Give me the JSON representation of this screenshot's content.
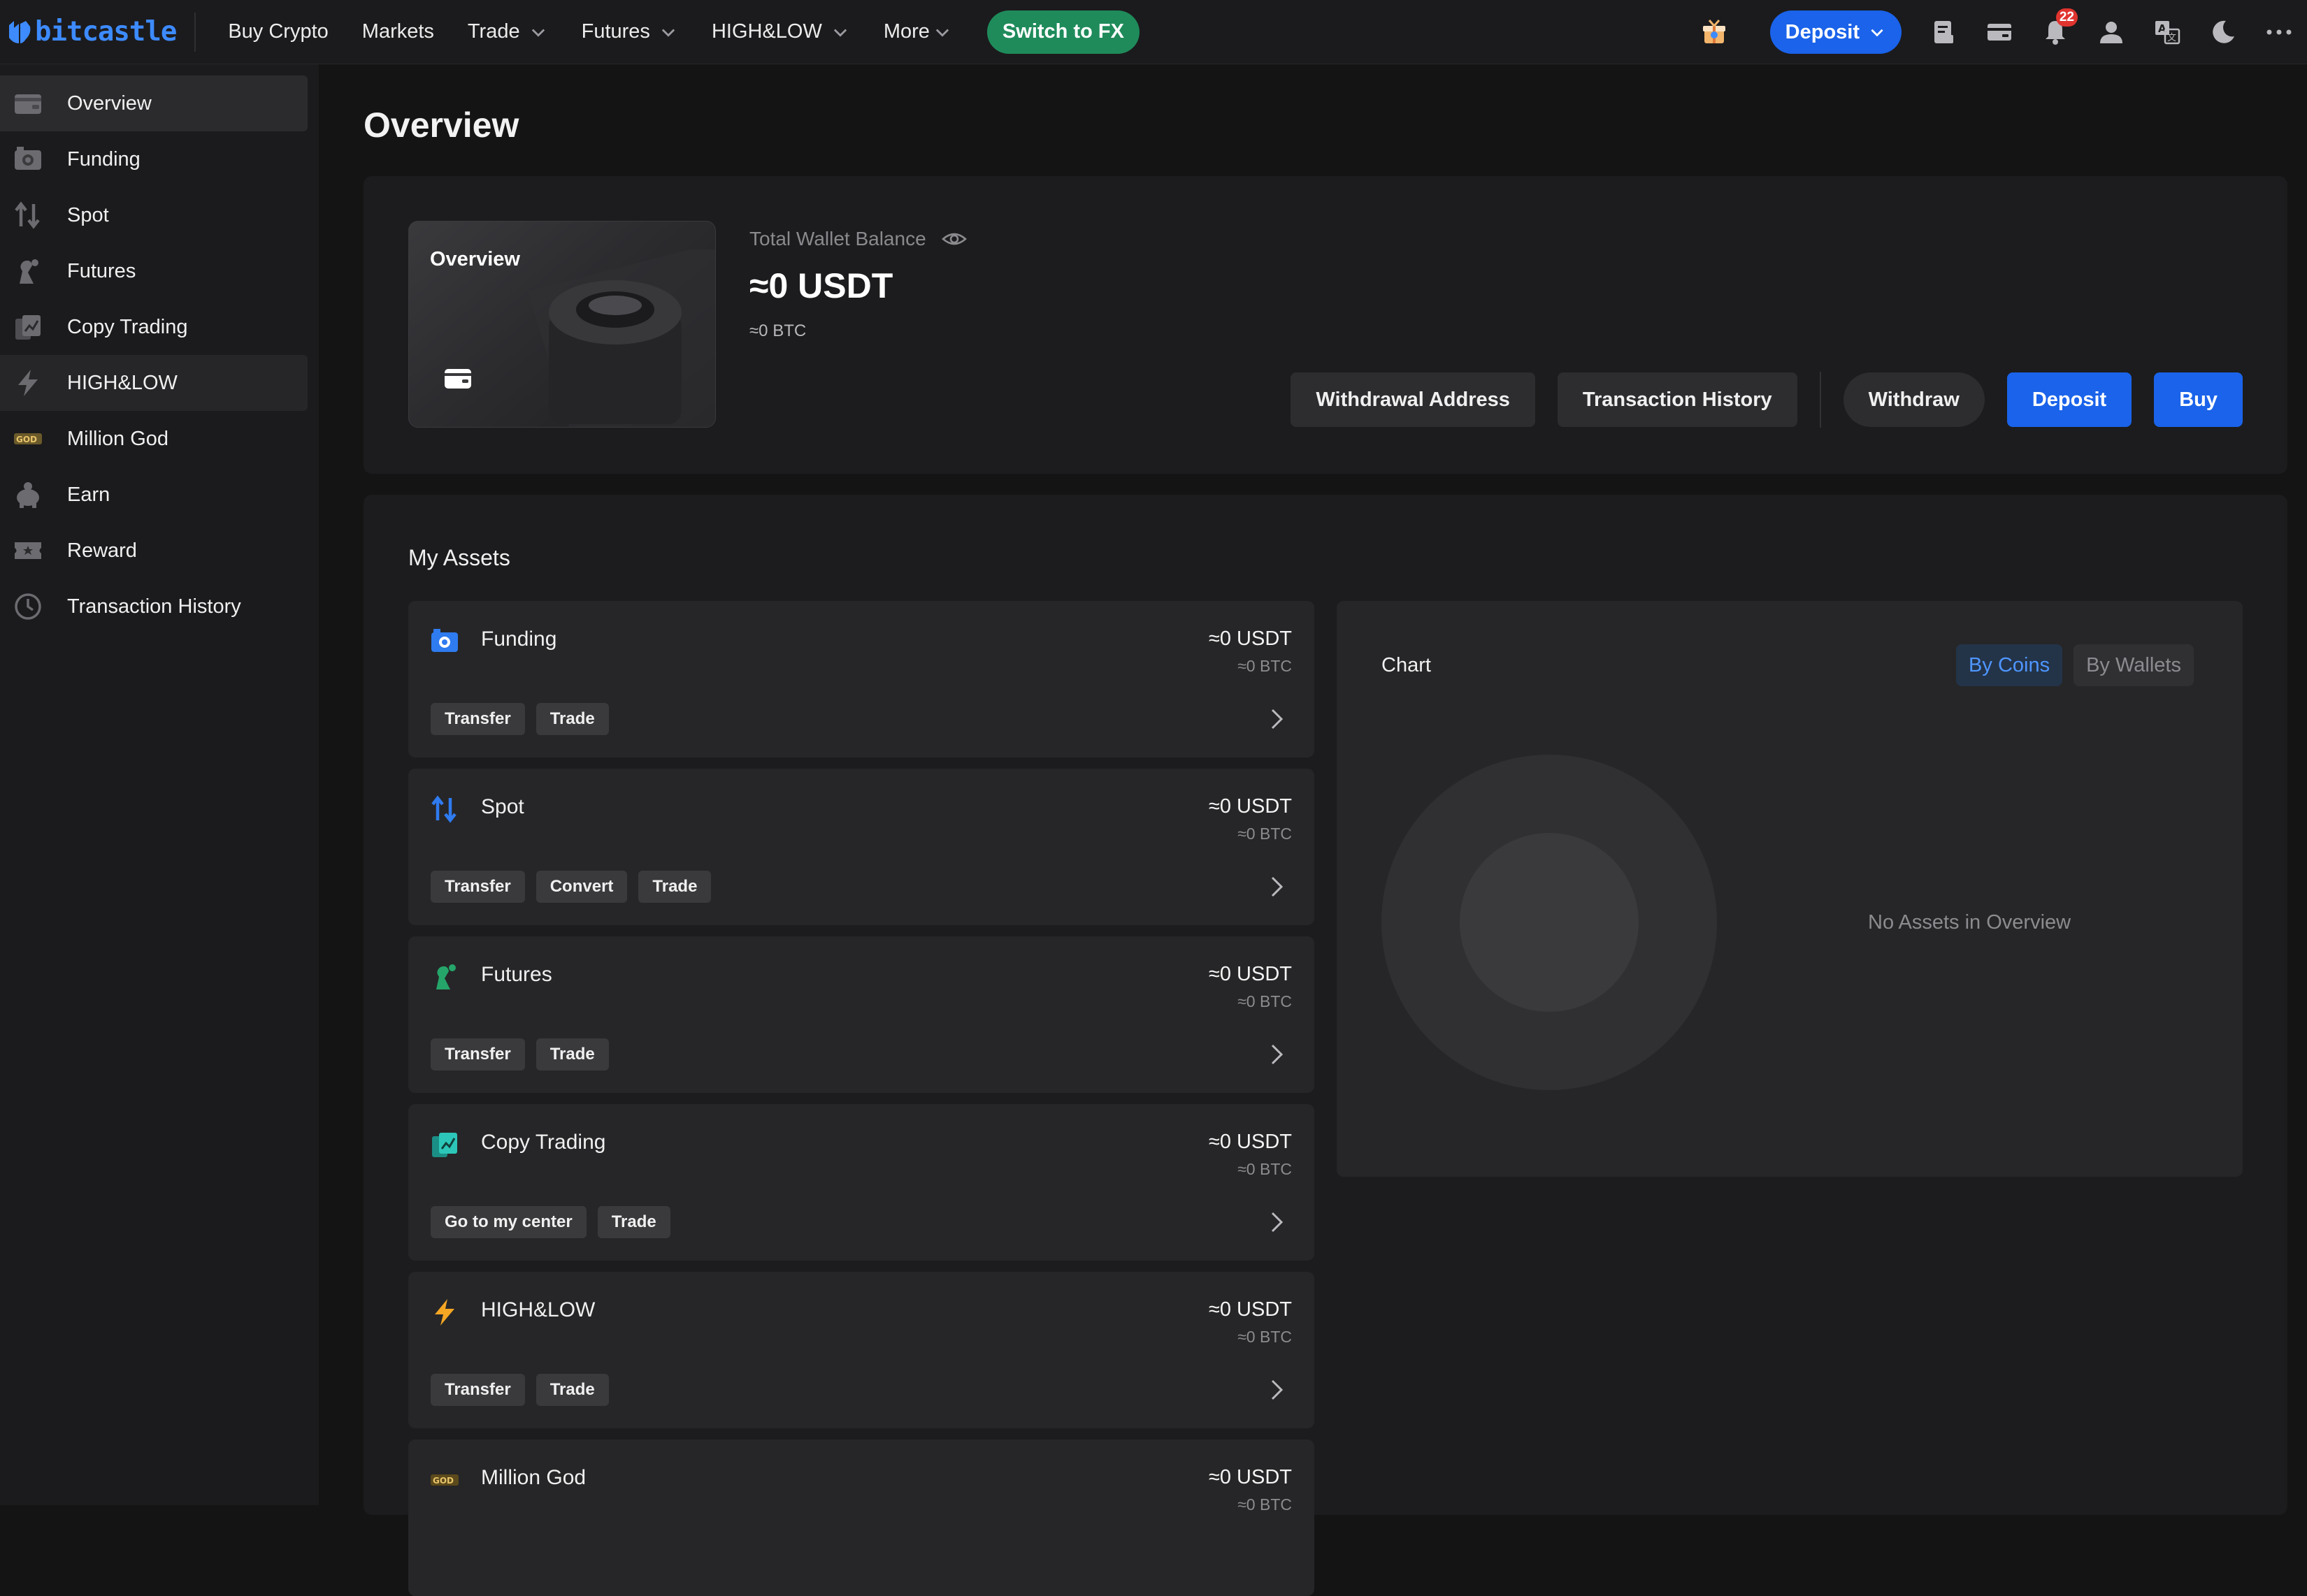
{
  "brand": {
    "name": "bitcastle"
  },
  "topnav": {
    "items": [
      {
        "label": "Buy Crypto",
        "has_dropdown": false
      },
      {
        "label": "Markets",
        "has_dropdown": false
      },
      {
        "label": "Trade",
        "has_dropdown": true
      },
      {
        "label": "Futures",
        "has_dropdown": true
      },
      {
        "label": "HIGH&LOW",
        "has_dropdown": true
      },
      {
        "label": "More",
        "has_dropdown": true
      }
    ],
    "fx_button": "Switch to FX",
    "deposit_button": "Deposit",
    "notification_count": "22",
    "icons": [
      "gift-box-icon",
      "orders-icon",
      "wallet-icon",
      "bell-icon",
      "user-icon",
      "language-icon",
      "moon-icon",
      "more-dots-icon"
    ]
  },
  "sidebar": {
    "items": [
      {
        "label": "Overview",
        "icon": "wallet-icon",
        "state": "active"
      },
      {
        "label": "Funding",
        "icon": "funding-icon"
      },
      {
        "label": "Spot",
        "icon": "spot-arrows-icon"
      },
      {
        "label": "Futures",
        "icon": "futures-icon"
      },
      {
        "label": "Copy Trading",
        "icon": "copy-trading-icon"
      },
      {
        "label": "HIGH&LOW",
        "icon": "lightning-icon",
        "state": "hover"
      },
      {
        "label": "Million God",
        "icon": "million-god-logo-icon"
      },
      {
        "label": "Earn",
        "icon": "earn-piggy-icon"
      },
      {
        "label": "Reward",
        "icon": "reward-ticket-icon"
      },
      {
        "label": "Transaction History",
        "icon": "clock-icon"
      }
    ]
  },
  "page": {
    "title": "Overview"
  },
  "overview": {
    "card_title": "Overview",
    "balance_label": "Total Wallet Balance",
    "balance_usdt": "≈0 USDT",
    "balance_btc": "≈0 BTC",
    "actions": {
      "withdrawal_address": "Withdrawal Address",
      "transaction_history": "Transaction History",
      "withdraw": "Withdraw",
      "deposit": "Deposit",
      "buy": "Buy"
    }
  },
  "assets": {
    "title": "My Assets",
    "cards": [
      {
        "name": "Funding",
        "icon": "funding-icon",
        "usdt": "≈0 USDT",
        "btc": "≈0 BTC",
        "tags": [
          "Transfer",
          "Trade"
        ]
      },
      {
        "name": "Spot",
        "icon": "spot-arrows-icon",
        "usdt": "≈0 USDT",
        "btc": "≈0 BTC",
        "tags": [
          "Transfer",
          "Convert",
          "Trade"
        ]
      },
      {
        "name": "Futures",
        "icon": "futures-icon",
        "usdt": "≈0 USDT",
        "btc": "≈0 BTC",
        "tags": [
          "Transfer",
          "Trade"
        ]
      },
      {
        "name": "Copy Trading",
        "icon": "copy-trading-icon",
        "usdt": "≈0 USDT",
        "btc": "≈0 BTC",
        "tags": [
          "Go to my center",
          "Trade"
        ]
      },
      {
        "name": "HIGH&LOW",
        "icon": "lightning-icon",
        "usdt": "≈0 USDT",
        "btc": "≈0 BTC",
        "tags": [
          "Transfer",
          "Trade"
        ]
      },
      {
        "name": "Million God",
        "icon": "million-god-logo-icon",
        "usdt": "≈0 USDT",
        "btc": "≈0 BTC",
        "tags": []
      }
    ],
    "chart": {
      "title": "Chart",
      "toggle": [
        "By Coins",
        "By Wallets"
      ],
      "selected": "By Coins",
      "empty_text": "No Assets in Overview"
    }
  },
  "colors": {
    "accent": "#1a63ea",
    "fx_green": "#1f8b5b",
    "page_bg": "#141414",
    "panel_bg": "#1c1c1e",
    "card_bg": "#262628"
  }
}
